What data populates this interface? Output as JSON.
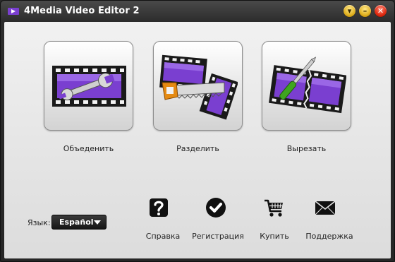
{
  "window": {
    "title": "4Media Video Editor 2",
    "help_glyph": "▾",
    "min_glyph": "–",
    "close_glyph": "✕"
  },
  "tiles": [
    {
      "label": "Объеденить",
      "icon": "film-wrench-icon"
    },
    {
      "label": "Разделить",
      "icon": "film-saw-icon"
    },
    {
      "label": "Вырезать",
      "icon": "film-scissors-icon"
    }
  ],
  "language": {
    "label": "Язык:",
    "selected": "Español"
  },
  "actions": [
    {
      "label": "Справка",
      "icon": "question-icon"
    },
    {
      "label": "Регистрация",
      "icon": "checkmark-icon"
    },
    {
      "label": "Купить",
      "icon": "cart-icon"
    },
    {
      "label": "Поддержка",
      "icon": "envelope-icon"
    }
  ],
  "colors": {
    "film_purple": "#7a3fd0",
    "film_black": "#1a1a1a",
    "close_red": "#e02a10",
    "button_yellow": "#e0b020"
  }
}
